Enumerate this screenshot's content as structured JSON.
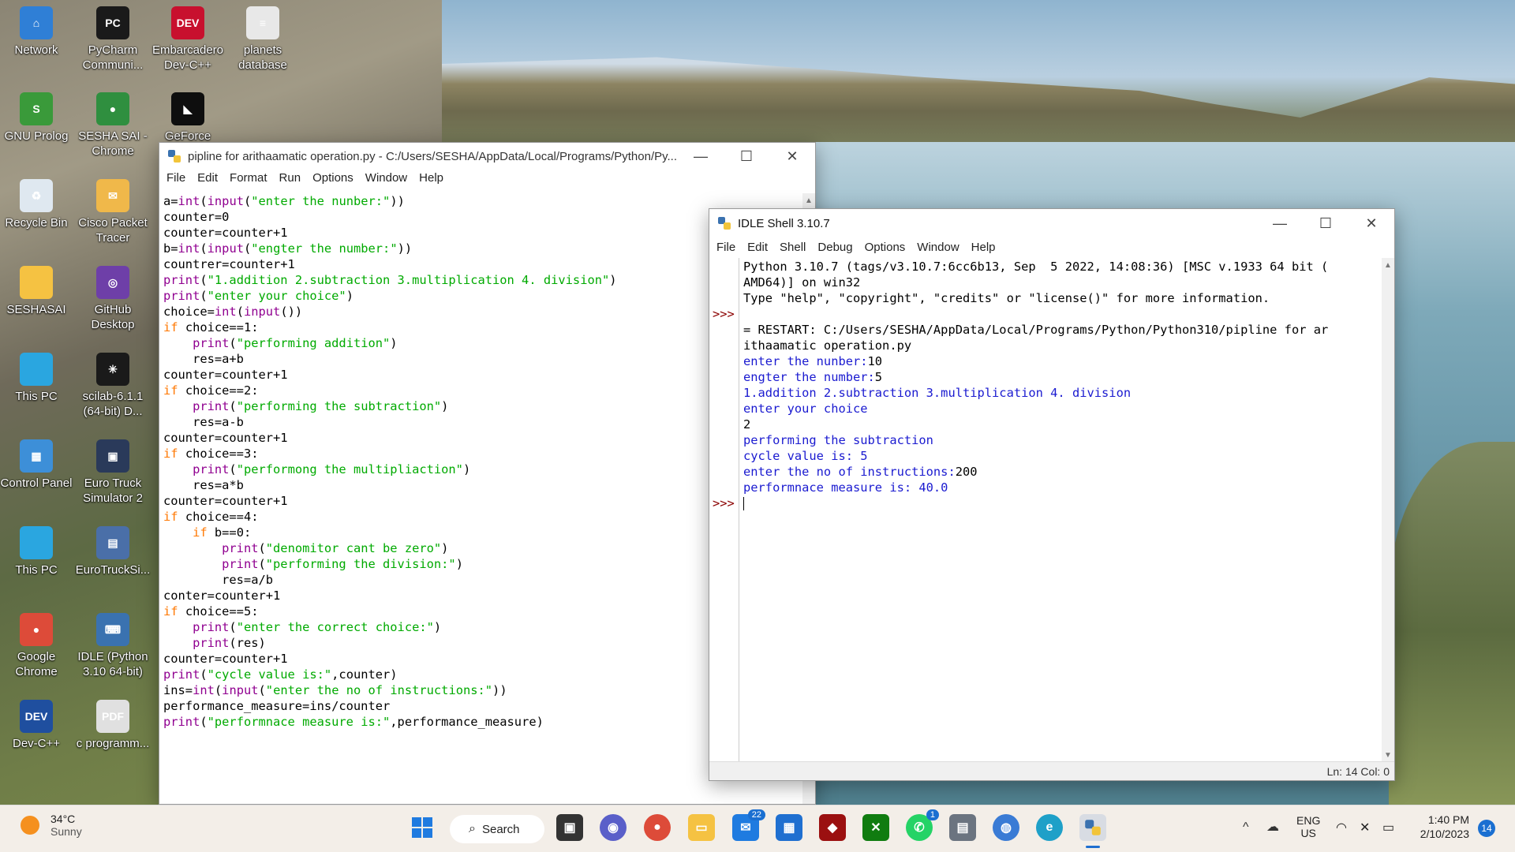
{
  "desktop": {
    "icons": [
      {
        "label": "Network",
        "icon": "network-icon",
        "color": "#2f7fd6",
        "glyph": "⌂"
      },
      {
        "label": "PyCharm Communi...",
        "icon": "pycharm-icon",
        "color": "#1a1a1a",
        "glyph": "PC"
      },
      {
        "label": "Embarcadero Dev-C++",
        "icon": "devcpp-icon",
        "color": "#c8102e",
        "glyph": "DEV"
      },
      {
        "label": "planets database",
        "icon": "document-icon",
        "color": "#e8e8e8",
        "glyph": "≡"
      },
      {
        "label": "GNU Prolog",
        "icon": "gnu-prolog-icon",
        "color": "#3a9a3a",
        "glyph": "S"
      },
      {
        "label": "SESHA SAI - Chrome",
        "icon": "chrome-icon",
        "color": "#2f8f3f",
        "glyph": "●"
      },
      {
        "label": "GeForce",
        "icon": "geforce-icon",
        "color": "#0e0e0e",
        "glyph": "◣"
      },
      {
        "label": "Recycle Bin",
        "icon": "recycle-bin-icon",
        "color": "#dfe8f0",
        "glyph": "♻"
      },
      {
        "label": "Cisco Packet Tracer",
        "icon": "cisco-icon",
        "color": "#f0b84a",
        "glyph": "✉"
      },
      {
        "label": "SESHASAI",
        "icon": "folder-icon",
        "color": "#f5c242",
        "glyph": ""
      },
      {
        "label": "GitHub Desktop",
        "icon": "github-icon",
        "color": "#6e3fa8",
        "glyph": "◎"
      },
      {
        "label": "This PC",
        "icon": "this-pc-icon",
        "color": "#2aa6e0",
        "glyph": ""
      },
      {
        "label": "scilab-6.1.1 (64-bit) D...",
        "icon": "scilab-icon",
        "color": "#1a1a1a",
        "glyph": "✳"
      },
      {
        "label": "Control Panel",
        "icon": "control-panel-icon",
        "color": "#3d8fd8",
        "glyph": "▦"
      },
      {
        "label": "Euro Truck Simulator 2",
        "icon": "euro-truck-icon",
        "color": "#2a3a5a",
        "glyph": "▣"
      },
      {
        "label": "This PC",
        "icon": "this-pc-icon",
        "color": "#2aa6e0",
        "glyph": ""
      },
      {
        "label": "EuroTruckSi...",
        "icon": "document-icon",
        "color": "#4a6fa8",
        "glyph": "▤"
      },
      {
        "label": "Google Chrome",
        "icon": "chrome-icon",
        "color": "#dd4b39",
        "glyph": "●"
      },
      {
        "label": "IDLE (Python 3.10 64-bit)",
        "icon": "idle-icon",
        "color": "#3a72b0",
        "glyph": "⌨"
      },
      {
        "label": "Dev-C++",
        "icon": "devcpp-icon",
        "color": "#1f4f9f",
        "glyph": "DEV"
      },
      {
        "label": "c programm...",
        "icon": "pdf-icon",
        "color": "#e0e0e0",
        "glyph": "PDF"
      }
    ]
  },
  "editor": {
    "title": "pipline for arithaamatic operation.py - C:/Users/SESHA/AppData/Local/Programs/Python/Py...",
    "menu": [
      "File",
      "Edit",
      "Format",
      "Run",
      "Options",
      "Window",
      "Help"
    ],
    "lines": [
      [
        [
          "",
          "a="
        ],
        [
          "bi",
          "int"
        ],
        [
          "",
          "("
        ],
        [
          "bi",
          "input"
        ],
        [
          "",
          "("
        ],
        [
          "str",
          "\"enter the nunber:\""
        ],
        [
          "",
          "))"
        ]
      ],
      [
        [
          "",
          "counter=0"
        ]
      ],
      [
        [
          "",
          "counter=counter+1"
        ]
      ],
      [
        [
          "",
          "b="
        ],
        [
          "bi",
          "int"
        ],
        [
          "",
          "("
        ],
        [
          "bi",
          "input"
        ],
        [
          "",
          "("
        ],
        [
          "str",
          "\"engter the number:\""
        ],
        [
          "",
          "))"
        ]
      ],
      [
        [
          "",
          "countrer=counter+1"
        ]
      ],
      [
        [
          "bi",
          "print"
        ],
        [
          "",
          "("
        ],
        [
          "str",
          "\"1.addition 2.subtraction 3.multiplication 4. division\""
        ],
        [
          "",
          ")"
        ]
      ],
      [
        [
          "bi",
          "print"
        ],
        [
          "",
          "("
        ],
        [
          "str",
          "\"enter your choice\""
        ],
        [
          "",
          ")"
        ]
      ],
      [
        [
          "",
          "choice="
        ],
        [
          "bi",
          "int"
        ],
        [
          "",
          "("
        ],
        [
          "bi",
          "input"
        ],
        [
          "",
          "())"
        ]
      ],
      [
        [
          "kw",
          "if"
        ],
        [
          "",
          " choice==1:"
        ]
      ],
      [
        [
          "",
          "    "
        ],
        [
          "bi",
          "print"
        ],
        [
          "",
          "("
        ],
        [
          "str",
          "\"performing addition\""
        ],
        [
          "",
          ")"
        ]
      ],
      [
        [
          "",
          "    res=a+b"
        ]
      ],
      [
        [
          "",
          "counter=counter+1"
        ]
      ],
      [
        [
          "kw",
          "if"
        ],
        [
          "",
          " choice==2:"
        ]
      ],
      [
        [
          "",
          "    "
        ],
        [
          "bi",
          "print"
        ],
        [
          "",
          "("
        ],
        [
          "str",
          "\"performing the subtraction\""
        ],
        [
          "",
          ")"
        ]
      ],
      [
        [
          "",
          "    res=a-b"
        ]
      ],
      [
        [
          "",
          "counter=counter+1"
        ]
      ],
      [
        [
          "kw",
          "if"
        ],
        [
          "",
          " choice==3:"
        ]
      ],
      [
        [
          "",
          "    "
        ],
        [
          "bi",
          "print"
        ],
        [
          "",
          "("
        ],
        [
          "str",
          "\"performong the multipliaction\""
        ],
        [
          "",
          ")"
        ]
      ],
      [
        [
          "",
          "    res=a*b"
        ]
      ],
      [
        [
          "",
          "counter=counter+1"
        ]
      ],
      [
        [
          "kw",
          "if"
        ],
        [
          "",
          " choice==4:"
        ]
      ],
      [
        [
          "",
          "    "
        ],
        [
          "kw",
          "if"
        ],
        [
          "",
          " b==0:"
        ]
      ],
      [
        [
          "",
          "        "
        ],
        [
          "bi",
          "print"
        ],
        [
          "",
          "("
        ],
        [
          "str",
          "\"denomitor cant be zero\""
        ],
        [
          "",
          ")"
        ]
      ],
      [
        [
          "",
          "        "
        ],
        [
          "bi",
          "print"
        ],
        [
          "",
          "("
        ],
        [
          "str",
          "\"performing the division:\""
        ],
        [
          "",
          ")"
        ]
      ],
      [
        [
          "",
          "        res=a/b"
        ]
      ],
      [
        [
          "",
          "conter=counter+1"
        ]
      ],
      [
        [
          "kw",
          "if"
        ],
        [
          "",
          " choice==5:"
        ]
      ],
      [
        [
          "",
          "    "
        ],
        [
          "bi",
          "print"
        ],
        [
          "",
          "("
        ],
        [
          "str",
          "\"enter the correct choice:\""
        ],
        [
          "",
          ")"
        ]
      ],
      [
        [
          "",
          "    "
        ],
        [
          "bi",
          "print"
        ],
        [
          "",
          "(res)"
        ]
      ],
      [
        [
          "",
          "counter=counter+1"
        ]
      ],
      [
        [
          "bi",
          "print"
        ],
        [
          "",
          "("
        ],
        [
          "str",
          "\"cycle value is:\""
        ],
        [
          "",
          ",counter)"
        ]
      ],
      [
        [
          "",
          "ins="
        ],
        [
          "bi",
          "int"
        ],
        [
          "",
          "("
        ],
        [
          "bi",
          "input"
        ],
        [
          "",
          "("
        ],
        [
          "str",
          "\"enter the no of instructions:\""
        ],
        [
          "",
          "))"
        ]
      ],
      [
        [
          "",
          "performance_measure=ins/counter"
        ]
      ],
      [
        [
          "bi",
          "print"
        ],
        [
          "",
          "("
        ],
        [
          "str",
          "\"performnace measure is:\""
        ],
        [
          "",
          ",performance_measure)"
        ]
      ]
    ]
  },
  "shell": {
    "title": "IDLE Shell 3.10.7",
    "menu": [
      "File",
      "Edit",
      "Shell",
      "Debug",
      "Options",
      "Window",
      "Help"
    ],
    "prompt": ">>>",
    "lines": [
      {
        "type": "plain",
        "text": "Python 3.10.7 (tags/v3.10.7:6cc6b13, Sep  5 2022, 14:08:36) [MSC v.1933 64 bit ("
      },
      {
        "type": "plain",
        "text": "AMD64)] on win32"
      },
      {
        "type": "plain",
        "text": "Type \"help\", \"copyright\", \"credits\" or \"license()\" for more information."
      },
      {
        "type": "prompt",
        "text": ""
      },
      {
        "type": "plain",
        "text": "= RESTART: C:/Users/SESHA/AppData/Local/Programs/Python/Python310/pipline for ar"
      },
      {
        "type": "plain",
        "text": "ithaamatic operation.py"
      },
      {
        "type": "out",
        "text": "enter the nunber:",
        "input": "10"
      },
      {
        "type": "out",
        "text": "engter the number:",
        "input": "5"
      },
      {
        "type": "out",
        "text": "1.addition 2.subtraction 3.multiplication 4. division",
        "input": ""
      },
      {
        "type": "out",
        "text": "enter your choice",
        "input": ""
      },
      {
        "type": "plain",
        "text": "2"
      },
      {
        "type": "out",
        "text": "performing the subtraction",
        "input": ""
      },
      {
        "type": "out",
        "text": "cycle value is: 5",
        "input": ""
      },
      {
        "type": "out",
        "text": "enter the no of instructions:",
        "input": "200"
      },
      {
        "type": "out",
        "text": "performnace measure is: 40.0",
        "input": ""
      },
      {
        "type": "prompt",
        "text": ""
      }
    ],
    "status": "Ln: 14   Col: 0"
  },
  "taskbar": {
    "weather_temp": "34°C",
    "weather_text": "Sunny",
    "search_label": "Search",
    "lang_top": "ENG",
    "lang_bottom": "US",
    "time": "1:40 PM",
    "date": "2/10/2023",
    "notif_count": "14",
    "mail_badge": "22",
    "whatsapp_badge": "1"
  }
}
